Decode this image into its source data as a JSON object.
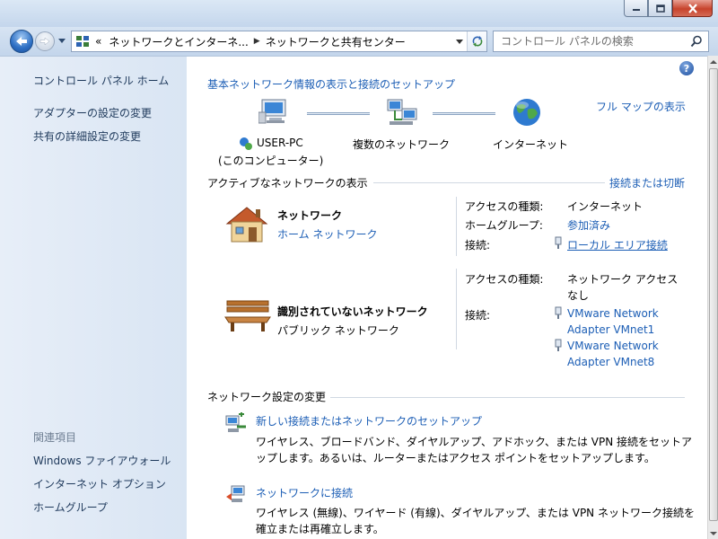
{
  "window": {
    "controls": [
      "minimize-icon",
      "maximize-icon",
      "close-icon"
    ]
  },
  "navbar": {
    "breadcrumb": {
      "root_marker": "«",
      "segments": [
        "ネットワークとインターネ...",
        "ネットワークと共有センター"
      ]
    },
    "search": {
      "placeholder": "コントロール パネルの検索"
    }
  },
  "sidebar": {
    "home": "コントロール パネル ホーム",
    "links": [
      "アダプターの設定の変更",
      "共有の詳細設定の変更"
    ],
    "related_heading": "関連項目",
    "related": [
      "Windows ファイアウォール",
      "インターネット オプション",
      "ホームグループ"
    ]
  },
  "main": {
    "help": "?",
    "title": "基本ネットワーク情報の表示と接続のセットアップ",
    "full_map": "フル マップの表示",
    "map": {
      "computer_name": "USER-PC",
      "computer_sub": "(このコンピューター)",
      "network": "複数のネットワーク",
      "internet": "インターネット"
    },
    "active_heading": "アクティブなネットワークの表示",
    "connect_disconnect": "接続または切断",
    "networks": [
      {
        "name": "ネットワーク",
        "type": "ホーム ネットワーク",
        "access_label": "アクセスの種類:",
        "access_value": "インターネット",
        "homegroup_label": "ホームグループ:",
        "homegroup_value": "参加済み",
        "conn_label": "接続:",
        "conn_value": "ローカル エリア接続"
      },
      {
        "name": "識別されていないネットワーク",
        "type": "パブリック ネットワーク",
        "access_label": "アクセスの種類:",
        "access_value_1": "ネットワーク アクセス",
        "access_value_2": "なし",
        "conn_label": "接続:",
        "conn_1_line1": "VMware Network",
        "conn_1_line2": "Adapter VMnet1",
        "conn_2_line1": "VMware Network",
        "conn_2_line2": "Adapter VMnet8"
      }
    ],
    "settings_heading": "ネットワーク設定の変更",
    "tasks": [
      {
        "title": "新しい接続またはネットワークのセットアップ",
        "desc": "ワイヤレス、ブロードバンド、ダイヤルアップ、アドホック、または VPN 接続をセットアップします。あるいは、ルーターまたはアクセス ポイントをセットアップします。"
      },
      {
        "title": "ネットワークに接続",
        "desc": "ワイヤレス (無線)、ワイヤード (有線)、ダイヤルアップ、または VPN ネットワーク接続を確立または再確立します。"
      }
    ]
  }
}
